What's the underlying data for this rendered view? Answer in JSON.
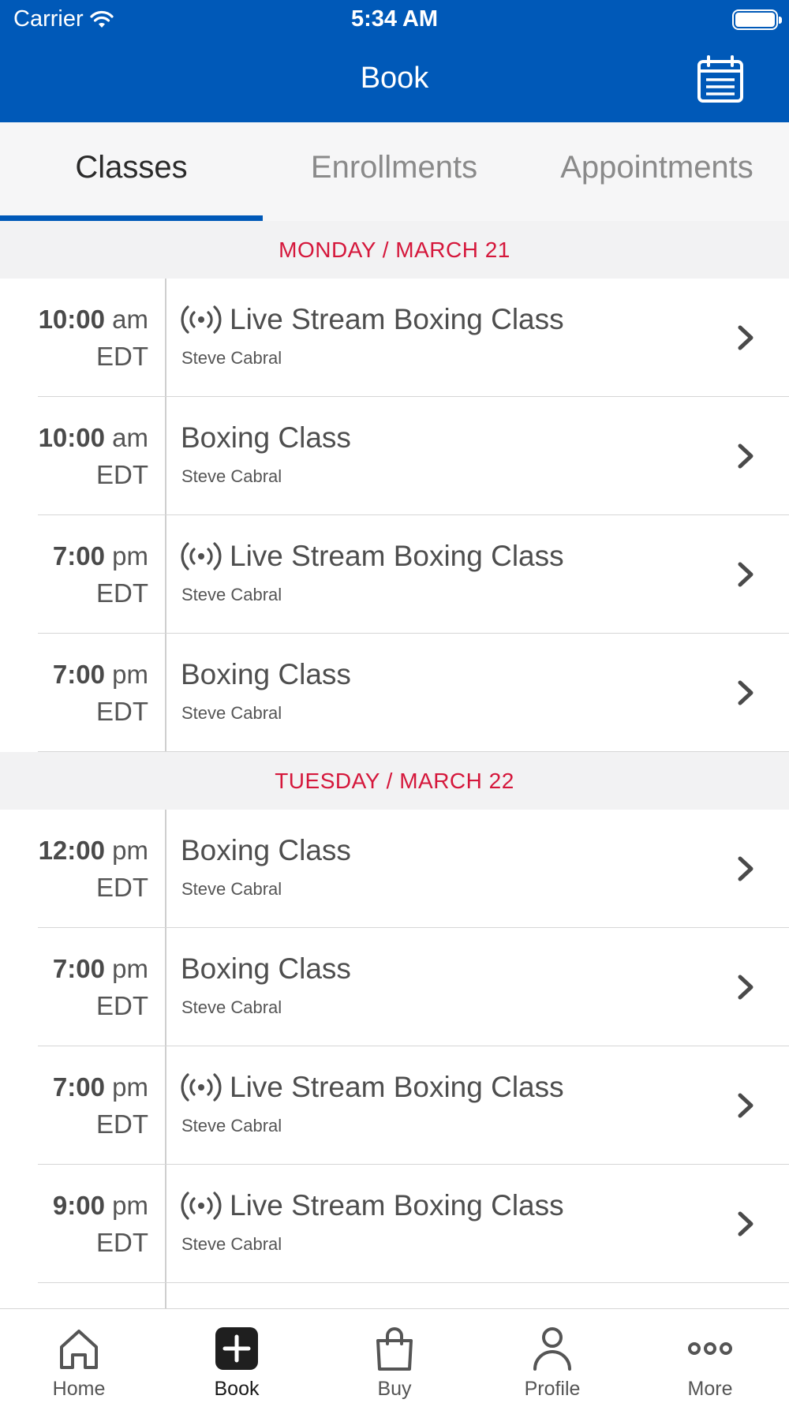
{
  "status_bar": {
    "carrier": "Carrier",
    "time": "5:34 AM"
  },
  "header": {
    "title": "Book",
    "calendar_icon": "calendar-list-icon",
    "color": "#0059b8"
  },
  "tabs": [
    {
      "label": "Classes",
      "active": true
    },
    {
      "label": "Enrollments",
      "active": false
    },
    {
      "label": "Appointments",
      "active": false
    }
  ],
  "days": [
    {
      "label": "MONDAY / MARCH 21",
      "classes": [
        {
          "time": "10:00",
          "ampm": "am",
          "tz": "EDT",
          "title": "Live Stream Boxing Class",
          "instructor": "Steve Cabral",
          "live": true
        },
        {
          "time": "10:00",
          "ampm": "am",
          "tz": "EDT",
          "title": "Boxing Class",
          "instructor": "Steve Cabral",
          "live": false
        },
        {
          "time": "7:00",
          "ampm": "pm",
          "tz": "EDT",
          "title": "Live Stream Boxing Class",
          "instructor": "Steve Cabral",
          "live": true
        },
        {
          "time": "7:00",
          "ampm": "pm",
          "tz": "EDT",
          "title": "Boxing Class",
          "instructor": "Steve Cabral",
          "live": false
        }
      ]
    },
    {
      "label": "TUESDAY / MARCH 22",
      "classes": [
        {
          "time": "12:00",
          "ampm": "pm",
          "tz": "EDT",
          "title": "Boxing Class",
          "instructor": "Steve Cabral",
          "live": false
        },
        {
          "time": "7:00",
          "ampm": "pm",
          "tz": "EDT",
          "title": "Boxing Class",
          "instructor": "Steve Cabral",
          "live": false
        },
        {
          "time": "7:00",
          "ampm": "pm",
          "tz": "EDT",
          "title": "Live Stream Boxing Class",
          "instructor": "Steve Cabral",
          "live": true
        },
        {
          "time": "9:00",
          "ampm": "pm",
          "tz": "EDT",
          "title": "Live Stream Boxing Class",
          "instructor": "Steve Cabral",
          "live": true
        }
      ]
    }
  ],
  "tabbar": [
    {
      "label": "Home",
      "icon": "home-icon",
      "active": false
    },
    {
      "label": "Book",
      "icon": "book-plus-icon",
      "active": true
    },
    {
      "label": "Buy",
      "icon": "shopping-bag-icon",
      "active": false
    },
    {
      "label": "Profile",
      "icon": "profile-icon",
      "active": false
    },
    {
      "label": "More",
      "icon": "more-icon",
      "active": false
    }
  ],
  "colors": {
    "accent": "#0059b8",
    "day_header_text": "#d5173b"
  }
}
